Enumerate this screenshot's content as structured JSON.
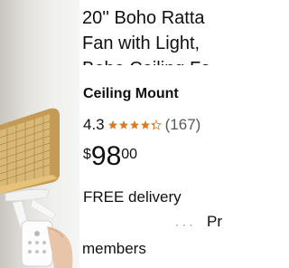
{
  "product": {
    "title_lines": [
      "20'' Boho Ratta",
      "Fan with Light,",
      "Boho Ceiling Fa"
    ],
    "subtitle": "Ceiling Mount",
    "rating": "4.3",
    "stars_icon": "star-rating-icon",
    "star_fill_fraction": 0.86,
    "review_count": "(167)",
    "price_symbol": "$",
    "price_whole": "98",
    "price_fraction": "00",
    "delivery": "FREE delivery",
    "prime_fragment": "Pr",
    "members": "members",
    "colors": {
      "star": "#de7921",
      "text": "#0f1111",
      "muted": "#565959"
    }
  }
}
